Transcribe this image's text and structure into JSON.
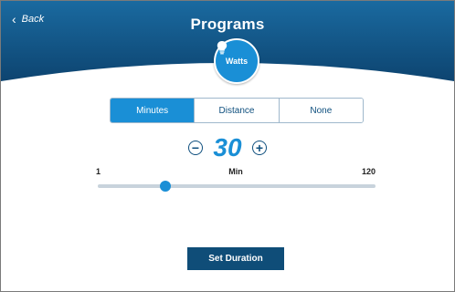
{
  "header": {
    "back_label": "Back",
    "title": "Programs"
  },
  "badge": {
    "label": "Watts",
    "icon": "lightbulb-icon"
  },
  "tabs": [
    {
      "label": "Minutes",
      "active": true
    },
    {
      "label": "Distance",
      "active": false
    },
    {
      "label": "None",
      "active": false
    }
  ],
  "duration": {
    "value": "30",
    "min_label": "1",
    "unit_label": "Min",
    "max_label": "120",
    "slider": {
      "min": 1,
      "max": 120,
      "value": 30
    }
  },
  "actions": {
    "set_duration_label": "Set Duration"
  },
  "colors": {
    "accent": "#1a8fd6",
    "header_dark": "#0f4d78",
    "track": "#c8d3dc"
  }
}
